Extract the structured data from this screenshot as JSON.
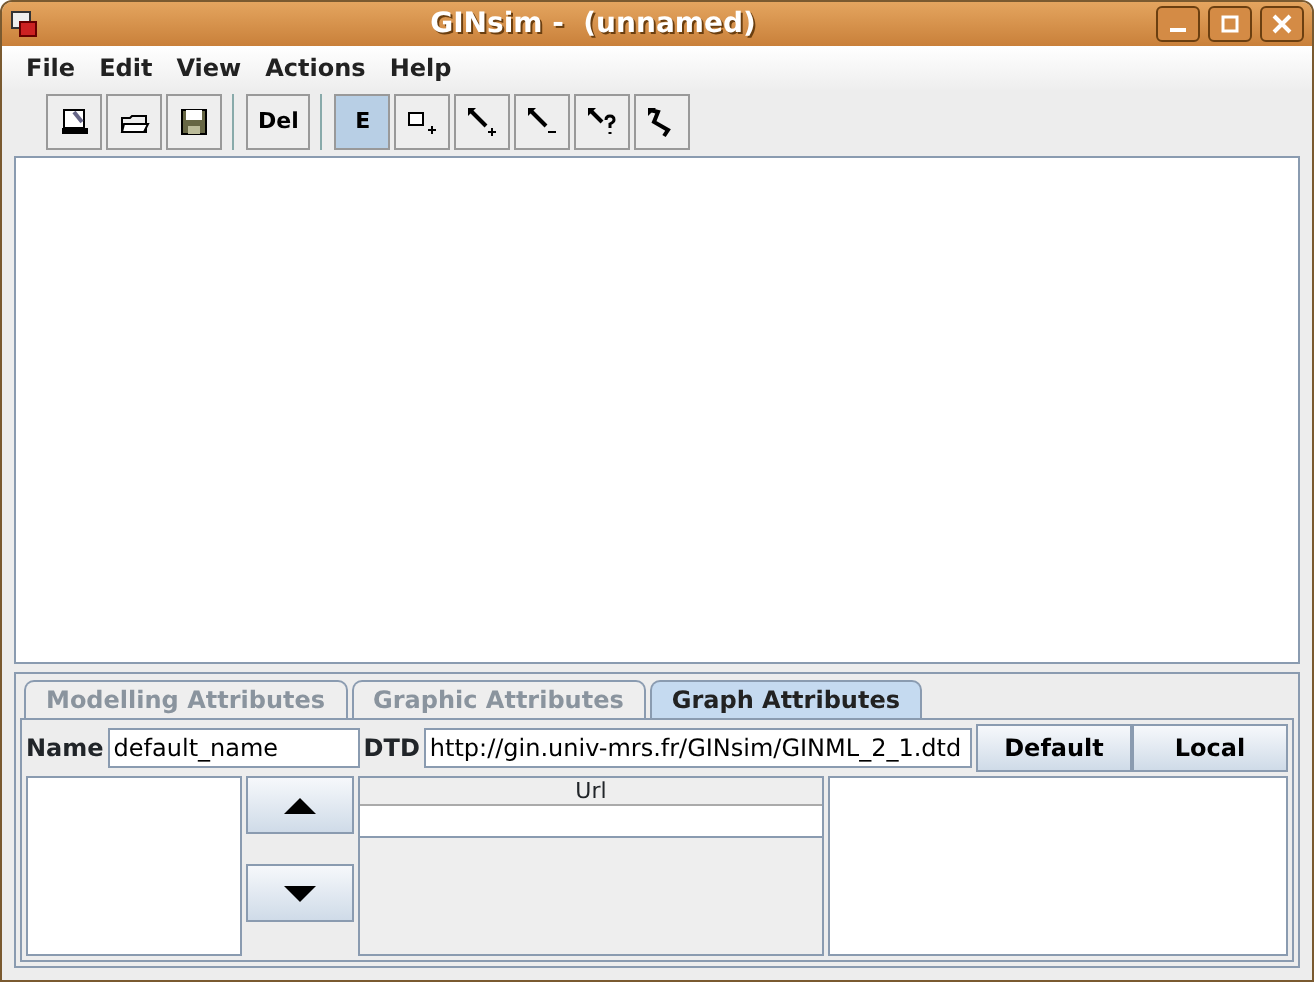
{
  "window": {
    "title": "GINsim -  (unnamed)"
  },
  "menu": [
    "File",
    "Edit",
    "View",
    "Actions",
    "Help"
  ],
  "toolbar": [
    {
      "kind": "icon",
      "selected": false
    },
    {
      "kind": "icon",
      "selected": false
    },
    {
      "kind": "icon",
      "selected": false
    },
    {
      "kind": "sep"
    },
    {
      "kind": "text",
      "label": "Del",
      "selected": false
    },
    {
      "kind": "sep"
    },
    {
      "kind": "text",
      "label": "E",
      "selected": true
    },
    {
      "kind": "icon",
      "selected": false
    },
    {
      "kind": "icon",
      "selected": false
    },
    {
      "kind": "icon",
      "selected": false
    },
    {
      "kind": "icon",
      "selected": false
    },
    {
      "kind": "icon",
      "selected": false
    }
  ],
  "tabs": [
    {
      "label": "Modelling Attributes",
      "selected": false
    },
    {
      "label": "Graphic Attributes",
      "selected": false
    },
    {
      "label": "Graph Attributes",
      "selected": true
    }
  ],
  "name_field": {
    "label": "Name",
    "value": "default_name"
  },
  "dtd_field": {
    "label": "DTD",
    "value": "http://gin.univ-mrs.fr/GINsim/GINML_2_1.dtd"
  },
  "buttons": [
    "Default",
    "Local"
  ],
  "table": {
    "columns": [
      "Url"
    ]
  }
}
